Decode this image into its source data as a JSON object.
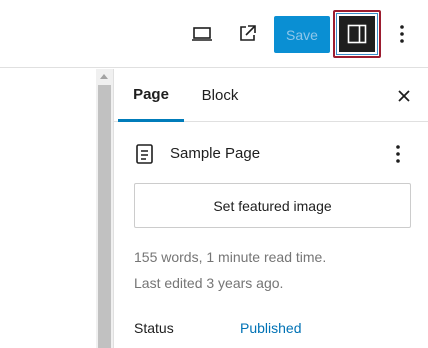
{
  "toolbar": {
    "save_label": "Save",
    "icons": [
      "preview-desktop-icon",
      "external-link-icon",
      "sidebar-toggle-icon",
      "more-vertical-icon"
    ]
  },
  "sidebar": {
    "tabs": [
      {
        "label": "Page",
        "active": true
      },
      {
        "label": "Block",
        "active": false
      }
    ],
    "document": {
      "title": "Sample Page"
    },
    "featured_image_label": "Set featured image",
    "meta": {
      "words": "155 words, 1 minute read time.",
      "edited": "Last edited 3 years ago."
    },
    "status": {
      "label": "Status",
      "value": "Published"
    }
  },
  "colors": {
    "accent": "#007cba",
    "save_bg": "#0a8fd3",
    "highlight_border": "#9c1c2f",
    "link": "#0072b5"
  }
}
